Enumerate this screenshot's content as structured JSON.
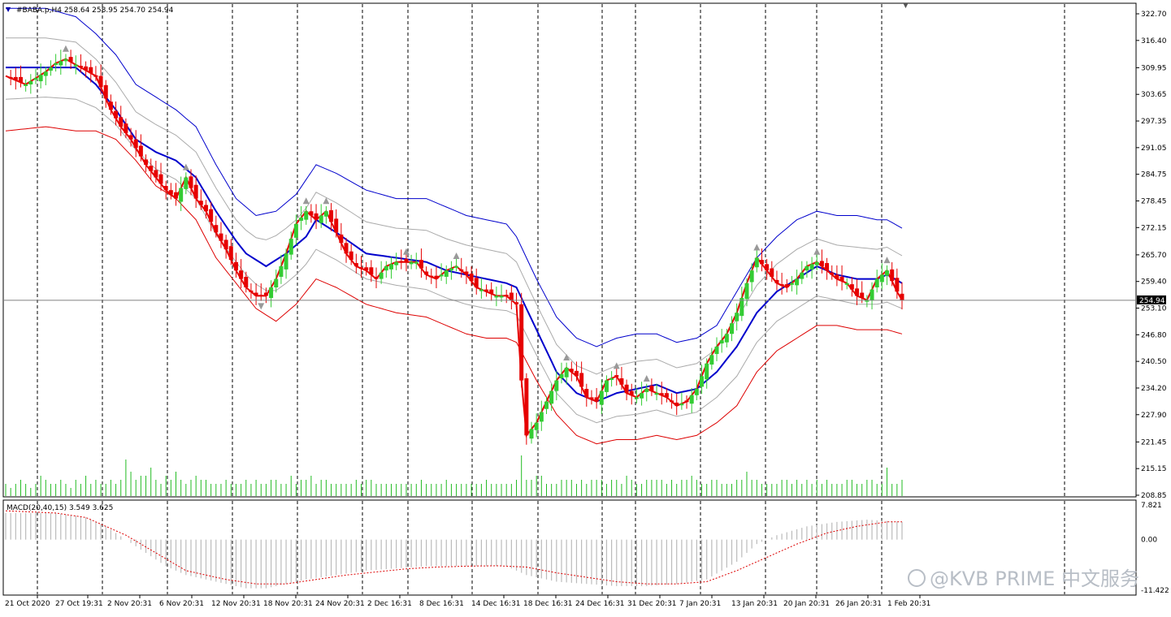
{
  "header": {
    "symbol_line": "#BABA.p,H4  258.64 258.95 254.70 254.94",
    "macd_line": "MACD(20,40,15) 3.549 3.625"
  },
  "watermark": "@KVB PRIME 中文服务",
  "colors": {
    "bull": "#33cc33",
    "bear": "#e60000",
    "ma_mid": "#0000cc",
    "band_upper": "#0000cc",
    "band_lower": "#dd0000",
    "inner_band": "#aaaaaa",
    "volume": "#22bb22",
    "macd_hist": "#bbbbbb",
    "macd_signal": "#dd0000",
    "grid": "#000000"
  },
  "chart_data": {
    "type": "line",
    "symbol": "#BABA.p",
    "timeframe": "H4",
    "price_axis": {
      "ticks": [
        "322.70",
        "316.40",
        "309.95",
        "303.65",
        "297.35",
        "291.05",
        "284.75",
        "278.45",
        "272.15",
        "265.70",
        "259.40",
        "253.10",
        "246.80",
        "240.50",
        "234.20",
        "227.90",
        "221.45",
        "215.15",
        "208.85"
      ],
      "current_price": "254.94",
      "ylim": [
        208.85,
        322.7
      ]
    },
    "macd_axis": {
      "ticks": [
        "7.821",
        "0.00",
        "-11.422"
      ],
      "ylim": [
        -11.422,
        7.821
      ]
    },
    "time_axis": [
      "21 Oct 2020",
      "27 Oct 19:31",
      "2 Nov 20:31",
      "6 Nov 20:31",
      "12 Nov 20:31",
      "18 Nov 20:31",
      "24 Nov 20:31",
      "2 Dec 16:31",
      "8 Dec 16:31",
      "14 Dec 16:31",
      "18 Dec 16:31",
      "24 Dec 16:31",
      "31 Dec 20:31",
      "7 Jan 20:31",
      "13 Jan 20:31",
      "20 Jan 20:31",
      "26 Jan 20:31",
      "1 Feb 20:31"
    ],
    "price_path": [
      [
        0,
        308
      ],
      [
        4,
        306
      ],
      [
        8,
        309
      ],
      [
        10,
        311
      ],
      [
        12,
        312
      ],
      [
        15,
        310
      ],
      [
        18,
        308
      ],
      [
        21,
        300
      ],
      [
        23,
        296
      ],
      [
        25,
        293
      ],
      [
        28,
        287
      ],
      [
        30,
        284
      ],
      [
        32,
        281
      ],
      [
        34,
        279
      ],
      [
        36,
        284
      ],
      [
        38,
        279
      ],
      [
        40,
        276
      ],
      [
        42,
        271
      ],
      [
        44,
        267
      ],
      [
        46,
        262
      ],
      [
        48,
        258
      ],
      [
        50,
        256
      ],
      [
        52,
        256
      ],
      [
        54,
        260
      ],
      [
        56,
        266
      ],
      [
        58,
        273
      ],
      [
        60,
        276
      ],
      [
        62,
        274
      ],
      [
        64,
        276
      ],
      [
        66,
        271
      ],
      [
        68,
        266
      ],
      [
        70,
        263
      ],
      [
        72,
        262
      ],
      [
        74,
        260
      ],
      [
        76,
        263
      ],
      [
        78,
        264
      ],
      [
        80,
        264
      ],
      [
        82,
        264
      ],
      [
        84,
        261
      ],
      [
        86,
        260
      ],
      [
        88,
        262
      ],
      [
        90,
        263
      ],
      [
        92,
        261
      ],
      [
        94,
        258
      ],
      [
        96,
        257
      ],
      [
        98,
        256
      ],
      [
        100,
        256
      ],
      [
        102,
        254
      ],
      [
        103,
        236
      ],
      [
        104,
        223
      ],
      [
        106,
        226
      ],
      [
        108,
        231
      ],
      [
        110,
        236
      ],
      [
        112,
        239
      ],
      [
        114,
        237
      ],
      [
        116,
        232
      ],
      [
        118,
        231
      ],
      [
        120,
        236
      ],
      [
        122,
        237
      ],
      [
        124,
        233
      ],
      [
        126,
        232
      ],
      [
        128,
        234
      ],
      [
        130,
        233
      ],
      [
        132,
        232
      ],
      [
        134,
        230
      ],
      [
        136,
        231
      ],
      [
        138,
        234
      ],
      [
        140,
        240
      ],
      [
        142,
        244
      ],
      [
        144,
        247
      ],
      [
        146,
        252
      ],
      [
        148,
        259
      ],
      [
        150,
        265
      ],
      [
        152,
        262
      ],
      [
        154,
        259
      ],
      [
        156,
        258
      ],
      [
        158,
        260
      ],
      [
        160,
        263
      ],
      [
        162,
        264
      ],
      [
        164,
        262
      ],
      [
        166,
        260
      ],
      [
        168,
        259
      ],
      [
        170,
        256
      ],
      [
        172,
        255
      ],
      [
        174,
        260
      ],
      [
        176,
        262
      ],
      [
        178,
        257
      ],
      [
        179,
        255
      ]
    ],
    "ma_mid": [
      [
        0,
        310
      ],
      [
        8,
        310
      ],
      [
        14,
        310
      ],
      [
        18,
        306
      ],
      [
        22,
        300
      ],
      [
        26,
        293
      ],
      [
        30,
        290
      ],
      [
        34,
        288
      ],
      [
        38,
        284
      ],
      [
        42,
        276
      ],
      [
        46,
        269
      ],
      [
        48,
        266
      ],
      [
        52,
        263
      ],
      [
        56,
        266
      ],
      [
        60,
        270
      ],
      [
        62,
        274
      ],
      [
        66,
        271
      ],
      [
        72,
        266
      ],
      [
        78,
        265
      ],
      [
        84,
        264
      ],
      [
        88,
        262
      ],
      [
        92,
        261
      ],
      [
        96,
        260
      ],
      [
        100,
        259
      ],
      [
        102,
        258
      ],
      [
        106,
        248
      ],
      [
        110,
        238
      ],
      [
        114,
        233
      ],
      [
        118,
        231
      ],
      [
        122,
        233
      ],
      [
        126,
        234
      ],
      [
        130,
        235
      ],
      [
        134,
        233
      ],
      [
        138,
        234
      ],
      [
        142,
        238
      ],
      [
        146,
        244
      ],
      [
        150,
        252
      ],
      [
        154,
        257
      ],
      [
        158,
        260
      ],
      [
        162,
        263
      ],
      [
        166,
        261
      ],
      [
        170,
        260
      ],
      [
        174,
        260
      ],
      [
        176,
        261
      ],
      [
        179,
        259
      ]
    ],
    "band_upper": [
      [
        0,
        324
      ],
      [
        8,
        324
      ],
      [
        14,
        322
      ],
      [
        18,
        318
      ],
      [
        22,
        313
      ],
      [
        26,
        306
      ],
      [
        30,
        303
      ],
      [
        34,
        300
      ],
      [
        38,
        296
      ],
      [
        42,
        287
      ],
      [
        46,
        279
      ],
      [
        50,
        275
      ],
      [
        54,
        276
      ],
      [
        58,
        280
      ],
      [
        62,
        287
      ],
      [
        66,
        285
      ],
      [
        72,
        281
      ],
      [
        78,
        279
      ],
      [
        84,
        279
      ],
      [
        88,
        277
      ],
      [
        92,
        275
      ],
      [
        96,
        274
      ],
      [
        100,
        273
      ],
      [
        102,
        270
      ],
      [
        106,
        260
      ],
      [
        110,
        251
      ],
      [
        114,
        246
      ],
      [
        118,
        244
      ],
      [
        122,
        246
      ],
      [
        126,
        247
      ],
      [
        130,
        247
      ],
      [
        134,
        245
      ],
      [
        138,
        246
      ],
      [
        142,
        249
      ],
      [
        146,
        257
      ],
      [
        150,
        265
      ],
      [
        154,
        270
      ],
      [
        158,
        274
      ],
      [
        162,
        276
      ],
      [
        166,
        275
      ],
      [
        170,
        275
      ],
      [
        174,
        274
      ],
      [
        176,
        274
      ],
      [
        179,
        272
      ]
    ],
    "band_lower": [
      [
        0,
        295
      ],
      [
        8,
        296
      ],
      [
        14,
        295
      ],
      [
        18,
        295
      ],
      [
        22,
        293
      ],
      [
        26,
        288
      ],
      [
        30,
        282
      ],
      [
        34,
        279
      ],
      [
        38,
        274
      ],
      [
        42,
        265
      ],
      [
        46,
        259
      ],
      [
        50,
        253
      ],
      [
        54,
        250
      ],
      [
        58,
        254
      ],
      [
        62,
        260
      ],
      [
        66,
        258
      ],
      [
        72,
        254
      ],
      [
        78,
        252
      ],
      [
        84,
        251
      ],
      [
        88,
        249
      ],
      [
        92,
        247
      ],
      [
        96,
        246
      ],
      [
        100,
        246
      ],
      [
        102,
        245
      ],
      [
        106,
        236
      ],
      [
        110,
        228
      ],
      [
        114,
        223
      ],
      [
        118,
        221
      ],
      [
        122,
        222
      ],
      [
        126,
        222
      ],
      [
        130,
        223
      ],
      [
        134,
        222
      ],
      [
        138,
        223
      ],
      [
        142,
        226
      ],
      [
        146,
        230
      ],
      [
        150,
        238
      ],
      [
        154,
        243
      ],
      [
        158,
        246
      ],
      [
        162,
        249
      ],
      [
        166,
        249
      ],
      [
        170,
        248
      ],
      [
        174,
        248
      ],
      [
        176,
        248
      ],
      [
        179,
        247
      ]
    ],
    "current_price_value": 254.94,
    "volume_relative": [
      3,
      2,
      3,
      4,
      3,
      2,
      3,
      5,
      4,
      3,
      3,
      4,
      3,
      2,
      4,
      3,
      5,
      3,
      4,
      3,
      3,
      4,
      3,
      4,
      9,
      6,
      4,
      5,
      5,
      7,
      4,
      3,
      5,
      4,
      6,
      4,
      3,
      4,
      5,
      4,
      4,
      3,
      3,
      3,
      4,
      3,
      3,
      3,
      4,
      3,
      4,
      3,
      3,
      4,
      4,
      3,
      3,
      5,
      3,
      4,
      4,
      5,
      3,
      4,
      4,
      3,
      3,
      3,
      3,
      3,
      4,
      3,
      4,
      4,
      3,
      3,
      3,
      3,
      3,
      3,
      3,
      3,
      3,
      4,
      3,
      3,
      3,
      3,
      4,
      3,
      3,
      3,
      3,
      3,
      3,
      3,
      4,
      3,
      3,
      3,
      3,
      3,
      4,
      10,
      4,
      4,
      5,
      5,
      3,
      3,
      3,
      4,
      4,
      4,
      3,
      4,
      3,
      4,
      4,
      4,
      3,
      4,
      4,
      3,
      5,
      4,
      3,
      3,
      4,
      4,
      4,
      4,
      3,
      4,
      3,
      4,
      4,
      5,
      4,
      3,
      3,
      4,
      4,
      3,
      3,
      3,
      4,
      4,
      6,
      4,
      4,
      3,
      3,
      3,
      3,
      4,
      4,
      3,
      4,
      3,
      4,
      3,
      4,
      3,
      4,
      3,
      3,
      3,
      4,
      4,
      3,
      3,
      4,
      4,
      3,
      3,
      7,
      3,
      3,
      4
    ],
    "macd_hist_relative": [
      [
        0,
        6
      ],
      [
        10,
        6
      ],
      [
        16,
        5
      ],
      [
        20,
        3
      ],
      [
        24,
        0
      ],
      [
        28,
        -3
      ],
      [
        32,
        -6
      ],
      [
        36,
        -8
      ],
      [
        40,
        -9
      ],
      [
        44,
        -10
      ],
      [
        48,
        -11
      ],
      [
        52,
        -11
      ],
      [
        56,
        -10
      ],
      [
        60,
        -9
      ],
      [
        66,
        -8
      ],
      [
        72,
        -7
      ],
      [
        78,
        -6.5
      ],
      [
        84,
        -6
      ],
      [
        90,
        -6
      ],
      [
        96,
        -6
      ],
      [
        100,
        -6
      ],
      [
        104,
        -8
      ],
      [
        110,
        -9.5
      ],
      [
        116,
        -10
      ],
      [
        122,
        -10.5
      ],
      [
        128,
        -10.5
      ],
      [
        134,
        -10
      ],
      [
        140,
        -9
      ],
      [
        146,
        -5
      ],
      [
        150,
        -1
      ],
      [
        154,
        1
      ],
      [
        160,
        3
      ],
      [
        166,
        4
      ],
      [
        172,
        4.5
      ],
      [
        179,
        4
      ]
    ],
    "macd_signal_relative": [
      [
        0,
        6.5
      ],
      [
        10,
        6
      ],
      [
        16,
        5
      ],
      [
        24,
        1
      ],
      [
        30,
        -3
      ],
      [
        36,
        -7
      ],
      [
        44,
        -9
      ],
      [
        50,
        -10
      ],
      [
        56,
        -10
      ],
      [
        62,
        -9
      ],
      [
        68,
        -8
      ],
      [
        74,
        -7.3
      ],
      [
        80,
        -6.6
      ],
      [
        86,
        -6.2
      ],
      [
        92,
        -6
      ],
      [
        98,
        -5.9
      ],
      [
        104,
        -6.2
      ],
      [
        110,
        -7.5
      ],
      [
        116,
        -8.5
      ],
      [
        122,
        -9.5
      ],
      [
        128,
        -10
      ],
      [
        134,
        -10
      ],
      [
        140,
        -9.5
      ],
      [
        146,
        -7
      ],
      [
        152,
        -4
      ],
      [
        158,
        -1
      ],
      [
        164,
        1.5
      ],
      [
        170,
        3
      ],
      [
        176,
        4
      ],
      [
        179,
        4
      ]
    ]
  }
}
